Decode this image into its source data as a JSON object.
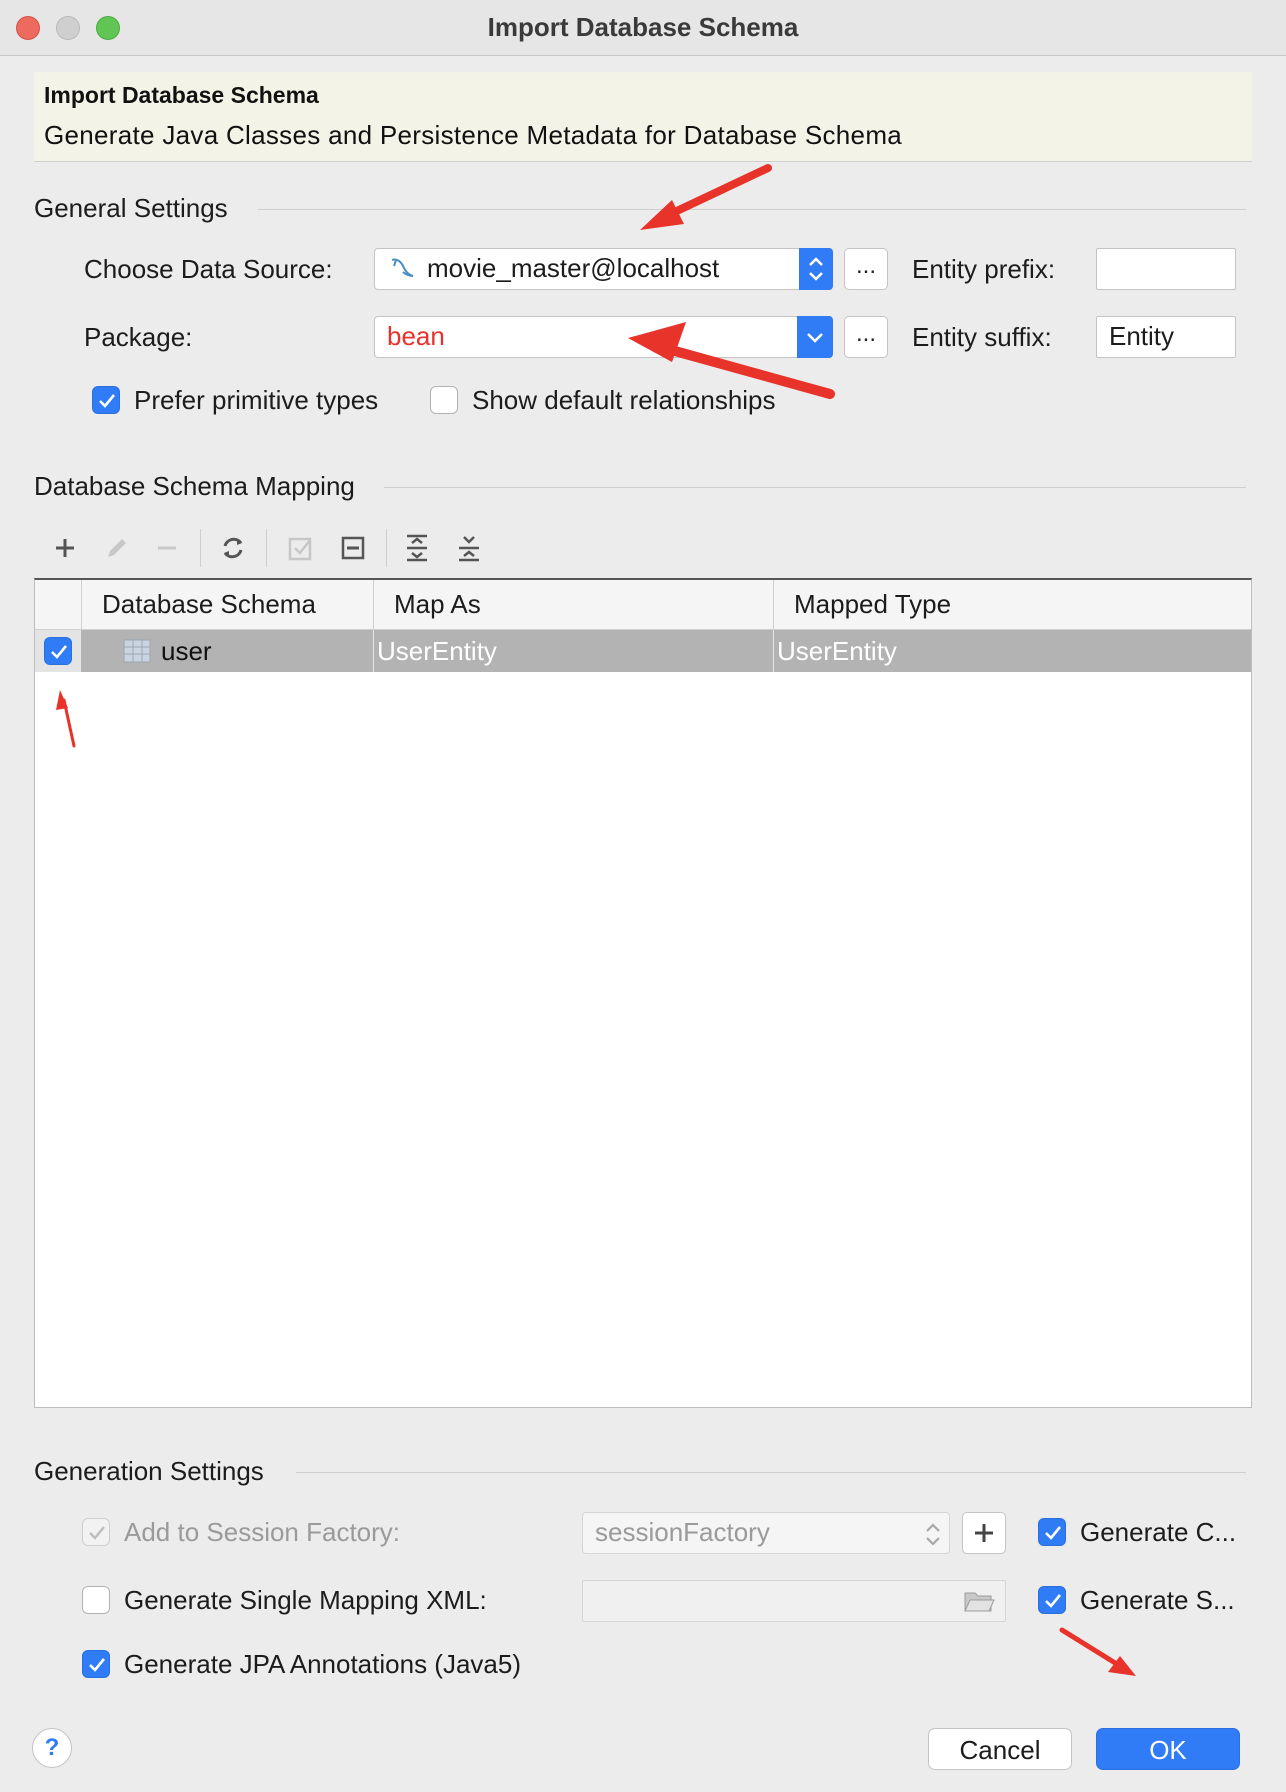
{
  "window": {
    "title": "Import Database Schema"
  },
  "banner": {
    "title": "Import Database Schema",
    "subtitle": "Generate Java Classes and Persistence Metadata for Database Schema"
  },
  "general": {
    "section_title": "General Settings",
    "data_source_label": "Choose Data Source:",
    "data_source_value": "movie_master@localhost",
    "package_label": "Package:",
    "package_value": "bean",
    "browse_label": "...",
    "entity_prefix_label": "Entity prefix:",
    "entity_prefix_value": "",
    "entity_suffix_label": "Entity suffix:",
    "entity_suffix_value": "Entity",
    "prefer_primitive_label": "Prefer primitive types",
    "prefer_primitive_checked": true,
    "show_default_rel_label": "Show default relationships",
    "show_default_rel_checked": false
  },
  "mapping": {
    "section_title": "Database Schema Mapping",
    "toolbar_icons": [
      "add-icon",
      "edit-icon",
      "remove-icon",
      "refresh-icon",
      "check-all-icon",
      "collapse-icon",
      "expand-all-icon",
      "collapse-all-icon"
    ],
    "columns": [
      "Database Schema",
      "Map As",
      "Mapped Type"
    ],
    "rows": [
      {
        "checked": true,
        "schema": "user",
        "map_as": "UserEntity",
        "mapped_type": "UserEntity"
      }
    ]
  },
  "generation": {
    "section_title": "Generation Settings",
    "session_factory_label": "Add to Session Factory:",
    "session_factory_value": "sessionFactory",
    "single_mapping_label": "Generate Single Mapping XML:",
    "jpa_label": "Generate JPA Annotations (Java5)",
    "gen_c_label": "Generate C...",
    "gen_s_label": "Generate S..."
  },
  "footer": {
    "help_label": "?",
    "cancel_label": "Cancel",
    "ok_label": "OK"
  },
  "colors": {
    "accent": "#2f7cf6",
    "annotation": "#e8332a",
    "package_text": "#e8332a"
  }
}
